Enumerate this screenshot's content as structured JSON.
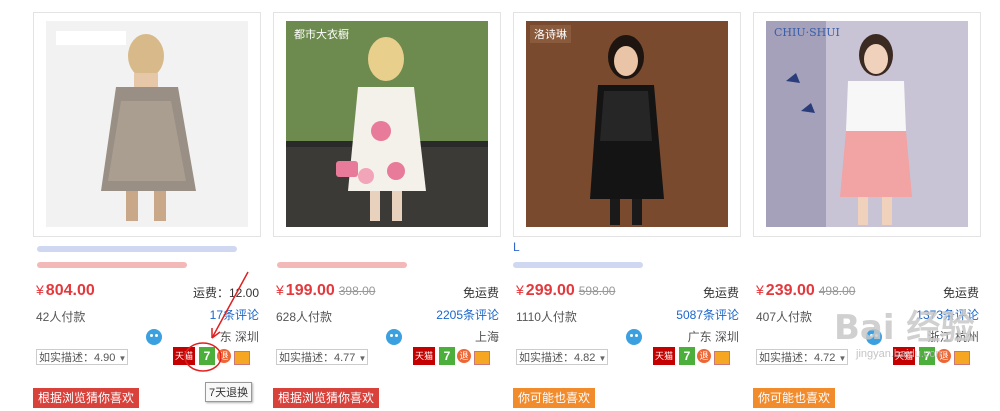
{
  "products": [
    {
      "title_visible": "",
      "price": "804.00",
      "orig_price": "",
      "shipping": "运费：12.00",
      "paid": "42人付款",
      "reviews": "17条评论",
      "location": "东 深圳",
      "rating": "如实描述：4.90",
      "recommend": "根据浏览猜你喜欢",
      "recommend_color": "#d9413b",
      "photo_bg": "#f2f2f2",
      "dress_color": "#9a8f84",
      "brand_text": ""
    },
    {
      "title_visible": "",
      "price": "199.00",
      "orig_price": "398.00",
      "shipping": "免运费",
      "paid": "628人付款",
      "reviews": "2205条评论",
      "location": "上海",
      "rating": "如实描述：4.77",
      "recommend": "根据浏览猜你喜欢",
      "recommend_color": "#d9413b",
      "photo_bg": "#6d8a4f",
      "dress_color": "#f4f0ea",
      "brand_text": "都市大衣橱"
    },
    {
      "title_visible": "L",
      "price": "299.00",
      "orig_price": "598.00",
      "shipping": "免运费",
      "paid": "1110人付款",
      "reviews": "5087条评论",
      "location": "广东 深圳",
      "rating": "如实描述：4.82",
      "recommend": "你可能也喜欢",
      "recommend_color": "#f28b2c",
      "photo_bg": "#7a4a2e",
      "dress_color": "#141414",
      "brand_text": "洛诗琳"
    },
    {
      "title_visible": "",
      "price": "239.00",
      "orig_price": "498.00",
      "shipping": "免运费",
      "paid": "407人付款",
      "reviews": "1373条评论",
      "location": "浙江 杭州",
      "rating": "如实描述：4.72",
      "recommend": "你可能也喜欢",
      "recommend_color": "#f28b2c",
      "photo_bg": "#c9c3d6",
      "dress_color": "#f2a3a3",
      "brand_text": "CHIU·SHUI"
    }
  ],
  "currency_symbol": "¥",
  "badges": {
    "tmall": "天猫",
    "seven": "7",
    "ret": "退",
    "tooltip": "7天退换"
  },
  "watermark": {
    "logo": "Bai 经验",
    "sub": "jingyan.baidu.com"
  },
  "colors": {
    "price": "#e4393c",
    "link": "#1a66cc",
    "annotation": "#e02020"
  }
}
